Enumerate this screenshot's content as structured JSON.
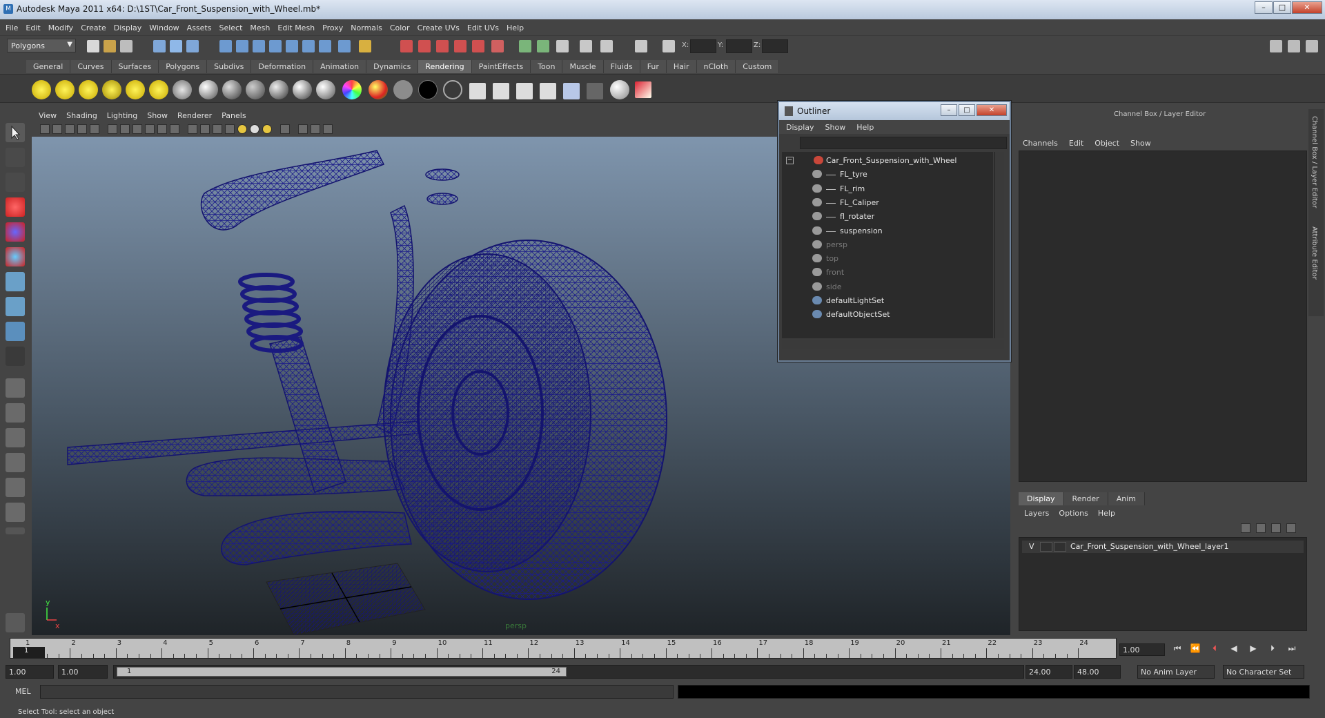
{
  "window": {
    "title": "Autodesk Maya 2011 x64: D:\\1ST\\Car_Front_Suspension_with_Wheel.mb*"
  },
  "menu": [
    "File",
    "Edit",
    "Modify",
    "Create",
    "Display",
    "Window",
    "Assets",
    "Select",
    "Mesh",
    "Edit Mesh",
    "Proxy",
    "Normals",
    "Color",
    "Create UVs",
    "Edit UVs",
    "Help"
  ],
  "status": {
    "mode": "Polygons",
    "x_label": "X:",
    "y_label": "Y:",
    "z_label": "Z:"
  },
  "shelf": {
    "tabs": [
      "General",
      "Curves",
      "Surfaces",
      "Polygons",
      "Subdivs",
      "Deformation",
      "Animation",
      "Dynamics",
      "Rendering",
      "PaintEffects",
      "Toon",
      "Muscle",
      "Fluids",
      "Fur",
      "Hair",
      "nCloth",
      "Custom"
    ],
    "active_tab": "Rendering"
  },
  "viewport": {
    "menu": [
      "View",
      "Shading",
      "Lighting",
      "Show",
      "Renderer",
      "Panels"
    ],
    "camera_label": "persp",
    "axis_y": "y",
    "axis_x": "x"
  },
  "outliner": {
    "title": "Outliner",
    "menu": [
      "Display",
      "Show",
      "Help"
    ],
    "items": [
      {
        "name": "Car_Front_Suspension_with_Wheel",
        "level": 0,
        "dim": false
      },
      {
        "name": "FL_tyre",
        "level": 1,
        "dim": false
      },
      {
        "name": "FL_rim",
        "level": 1,
        "dim": false
      },
      {
        "name": "FL_Caliper",
        "level": 1,
        "dim": false
      },
      {
        "name": "fl_rotater",
        "level": 1,
        "dim": false
      },
      {
        "name": "suspension",
        "level": 1,
        "dim": false
      },
      {
        "name": "persp",
        "level": 0,
        "dim": true
      },
      {
        "name": "top",
        "level": 0,
        "dim": true
      },
      {
        "name": "front",
        "level": 0,
        "dim": true
      },
      {
        "name": "side",
        "level": 0,
        "dim": true
      },
      {
        "name": "defaultLightSet",
        "level": 0,
        "dim": false
      },
      {
        "name": "defaultObjectSet",
        "level": 0,
        "dim": false
      }
    ]
  },
  "channel_box": {
    "title": "Channel Box / Layer Editor",
    "menu": [
      "Channels",
      "Edit",
      "Object",
      "Show"
    ],
    "side_tabs": [
      "Channel Box / Layer Editor",
      "Attribute Editor"
    ]
  },
  "layers": {
    "tabs": [
      "Display",
      "Render",
      "Anim"
    ],
    "active_tab": "Display",
    "menu": [
      "Layers",
      "Options",
      "Help"
    ],
    "row": {
      "visible": "V",
      "name": "Car_Front_Suspension_with_Wheel_layer1"
    }
  },
  "timeline": {
    "ticks": [
      "1",
      "2",
      "3",
      "4",
      "5",
      "6",
      "7",
      "8",
      "9",
      "10",
      "11",
      "12",
      "13",
      "14",
      "15",
      "16",
      "17",
      "18",
      "19",
      "20",
      "21",
      "22",
      "23",
      "24"
    ],
    "current_frame_marker": "1",
    "current_frame": "1.00",
    "range_start_outer": "1.00",
    "range_start_inner": "1.00",
    "range_knob_start": "1",
    "range_knob_end": "24",
    "range_end_inner": "24.00",
    "range_end_outer": "48.00",
    "anim_layer": "No Anim Layer",
    "character_set": "No Character Set"
  },
  "command": {
    "label": "MEL"
  },
  "help_line": "Select Tool: select an object"
}
